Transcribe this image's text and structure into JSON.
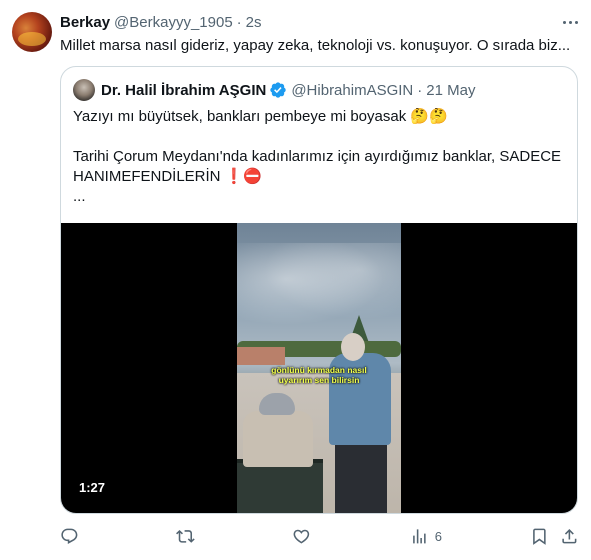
{
  "tweet": {
    "display_name": "Berkay",
    "handle": "@Berkayyy_1905",
    "separator": "·",
    "time": "2s",
    "text": "Millet marsa nasıl gideriz, yapay zeka, teknoloji vs. konuşuyor. O sırada biz...",
    "more_icon": "more-horizontal-icon"
  },
  "quoted_tweet": {
    "display_name": "Dr. Halil İbrahim AŞGIN",
    "verified_icon": "verified-badge-icon",
    "handle": "@HibrahimASGIN",
    "separator": "·",
    "date": "21 May",
    "lines": [
      "Yazıyı mı büyütsek, bankları pembeye mi boyasak 🤔🤔",
      "Tarihi Çorum Meydanı'nda kadınlarımız için ayırdığımız banklar, SADECE",
      "HANIMEFENDİLERİN  ❗⛔",
      "..."
    ],
    "video": {
      "caption_line1": "gönlünü kırmadan nasıl",
      "caption_line2": "uyarırım sen bilirsin",
      "duration": "1:27"
    }
  },
  "actions": {
    "reply_icon": "reply-icon",
    "retweet_icon": "retweet-icon",
    "like_icon": "heart-icon",
    "views_icon": "views-chart-icon",
    "views_count": "6",
    "bookmark_icon": "bookmark-icon",
    "share_icon": "share-icon"
  },
  "colors": {
    "text_primary": "#0f1419",
    "text_secondary": "#536471",
    "verified": "#1d9bf0",
    "border": "#cfd9de",
    "video_caption": "#f2ff4a"
  }
}
